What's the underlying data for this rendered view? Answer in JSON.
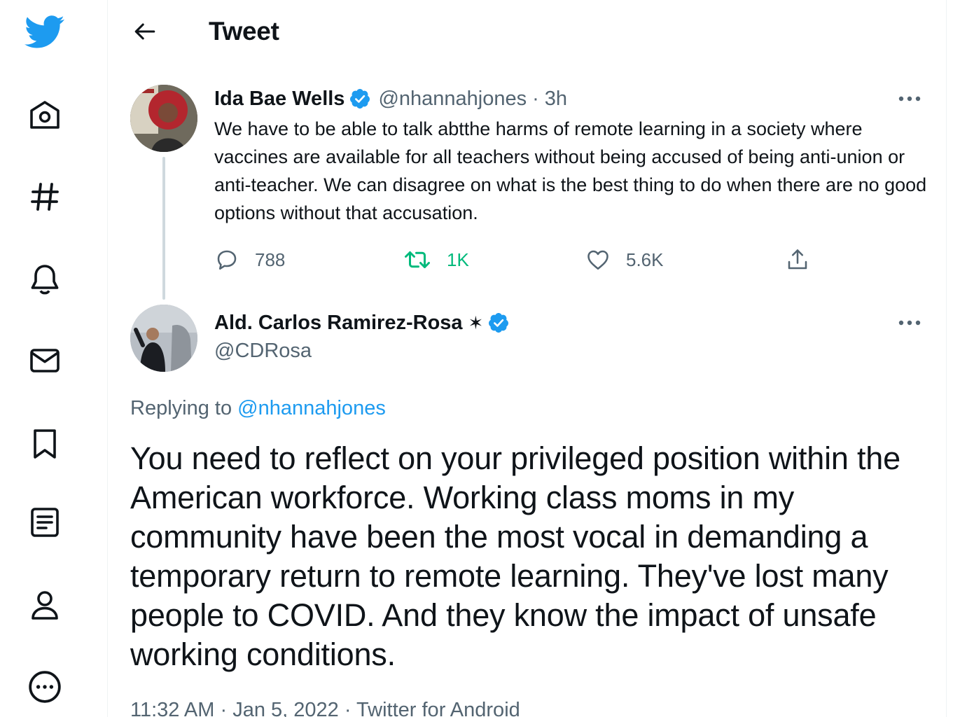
{
  "nav": {
    "items": [
      {
        "name": "twitter-logo-icon"
      },
      {
        "name": "home-icon"
      },
      {
        "name": "explore-hashtag-icon"
      },
      {
        "name": "notifications-bell-icon"
      },
      {
        "name": "messages-envelope-icon"
      },
      {
        "name": "bookmarks-icon"
      },
      {
        "name": "lists-icon"
      },
      {
        "name": "profile-icon"
      },
      {
        "name": "more-icon"
      }
    ]
  },
  "header": {
    "title": "Tweet"
  },
  "parent_tweet": {
    "display_name": "Ida Bae Wells",
    "handle": "@nhannahjones",
    "separator": "·",
    "time": "3h",
    "text": "We have to be able to talk abtthe harms of remote learning in a society where vaccines are available for all teachers without being accused of being anti-union or anti-teacher. We can disagree on what is the best thing to do when there are no good options without that accusation.",
    "replies": "788",
    "retweets": "1K",
    "likes": "5.6K"
  },
  "reply_tweet": {
    "display_name": "Ald. Carlos Ramirez-Rosa",
    "name_suffix": "✶",
    "handle": "@CDRosa",
    "replying_label": "Replying to",
    "replying_to": "@nhannahjones",
    "text": "You need to reflect on your privileged position within the American workforce. Working class moms in my community have been the most vocal in demanding a temporary return to remote learning. They've lost many people to COVID. And they know the impact of unsafe working conditions.",
    "time": "11:32 AM",
    "separator_1": "·",
    "date": "Jan 5, 2022",
    "separator_2": "·",
    "source": "Twitter for Android"
  },
  "colors": {
    "brand_blue": "#1d9bf0",
    "retweet_green": "#00ba7c",
    "text_primary": "#0f1419",
    "text_secondary": "#536471"
  }
}
